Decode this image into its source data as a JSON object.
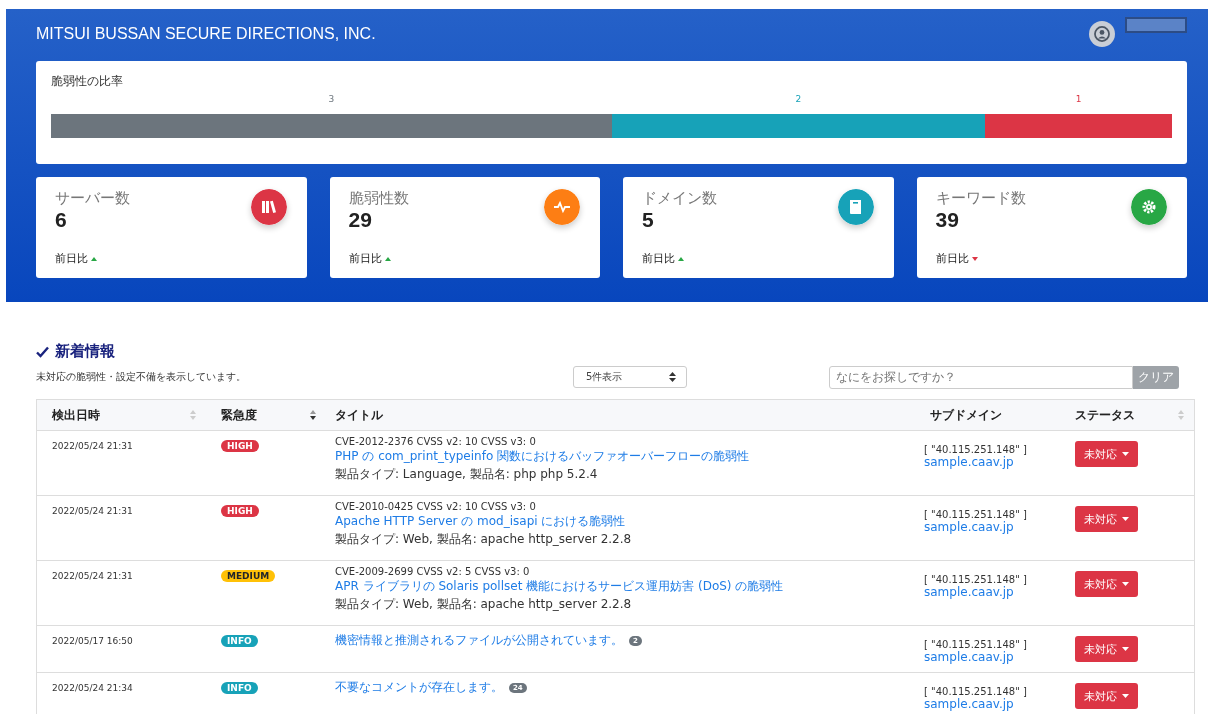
{
  "header": {
    "company": "MITSUI BUSSAN SECURE DIRECTIONS, INC."
  },
  "ratio": {
    "title": "脆弱性の比率",
    "segments": [
      {
        "label": "3",
        "color": "#6c757d"
      },
      {
        "label": "2",
        "color": "#17a2b8"
      },
      {
        "label": "1",
        "color": "#dc3545"
      }
    ]
  },
  "stats": [
    {
      "label": "サーバー数",
      "value": "6",
      "kind": "books",
      "color": "#dc3545",
      "compare": "前日比",
      "up": true
    },
    {
      "label": "脆弱性数",
      "value": "29",
      "kind": "pulse",
      "color": "#fd7e14",
      "compare": "前日比",
      "up": true
    },
    {
      "label": "ドメイン数",
      "value": "5",
      "kind": "book",
      "color": "#17a2b8",
      "compare": "前日比",
      "up": true
    },
    {
      "label": "キーワード数",
      "value": "39",
      "kind": "gear",
      "color": "#28a745",
      "compare": "前日比",
      "up": false
    }
  ],
  "news": {
    "title": "新着情報",
    "subtitle": "未対応の脆弱性・設定不備を表示しています。",
    "page_size": "5件表示",
    "search": {
      "placeholder": "なにをお探しですか？"
    },
    "clear": "クリア",
    "columns": [
      {
        "label": "検出日時",
        "sortable": true
      },
      {
        "label": "緊急度",
        "sortable": true
      },
      {
        "label": "タイトル",
        "sortable": false
      },
      {
        "label": "サブドメイン",
        "sortable": false
      },
      {
        "label": "ステータス",
        "sortable": true
      }
    ],
    "rows": [
      {
        "date": "2022/05/24 21:31",
        "severity": "HIGH",
        "kind": "high",
        "cve": "CVE-2012-2376 CVSS v2: 10 CVSS v3: 0",
        "title": "PHP の com_print_typeinfo 関数におけるバッファオーバーフローの脆弱性",
        "product": "製品タイプ: Language, 製品名: php php 5.2.4",
        "ip": "[ \"40.115.251.148\" ]",
        "domain": "sample.caav.jp",
        "status": "未対応"
      },
      {
        "date": "2022/05/24 21:31",
        "severity": "HIGH",
        "kind": "high",
        "cve": "CVE-2010-0425 CVSS v2: 10 CVSS v3: 0",
        "title": "Apache HTTP Server の mod_isapi における脆弱性",
        "product": "製品タイプ: Web, 製品名: apache http_server 2.2.8",
        "ip": "[ \"40.115.251.148\" ]",
        "domain": "sample.caav.jp",
        "status": "未対応"
      },
      {
        "date": "2022/05/24 21:31",
        "severity": "MEDIUM",
        "kind": "medium",
        "cve": "CVE-2009-2699 CVSS v2: 5 CVSS v3: 0",
        "title": "APR ライブラリの Solaris pollset 機能におけるサービス運用妨害 (DoS) の脆弱性",
        "product": "製品タイプ: Web, 製品名: apache http_server 2.2.8",
        "ip": "[ \"40.115.251.148\" ]",
        "domain": "sample.caav.jp",
        "status": "未対応"
      },
      {
        "date": "2022/05/17 16:50",
        "severity": "INFO",
        "kind": "info",
        "title": "機密情報と推測されるファイルが公開されています。",
        "count": "2",
        "ip": "[ \"40.115.251.148\" ]",
        "domain": "sample.caav.jp",
        "status": "未対応"
      },
      {
        "date": "2022/05/24 21:34",
        "severity": "INFO",
        "kind": "info",
        "title": "不要なコメントが存在します。",
        "count": "24",
        "ip": "[ \"40.115.251.148\" ]",
        "domain": "sample.caav.jp",
        "status": "未対応"
      }
    ]
  }
}
